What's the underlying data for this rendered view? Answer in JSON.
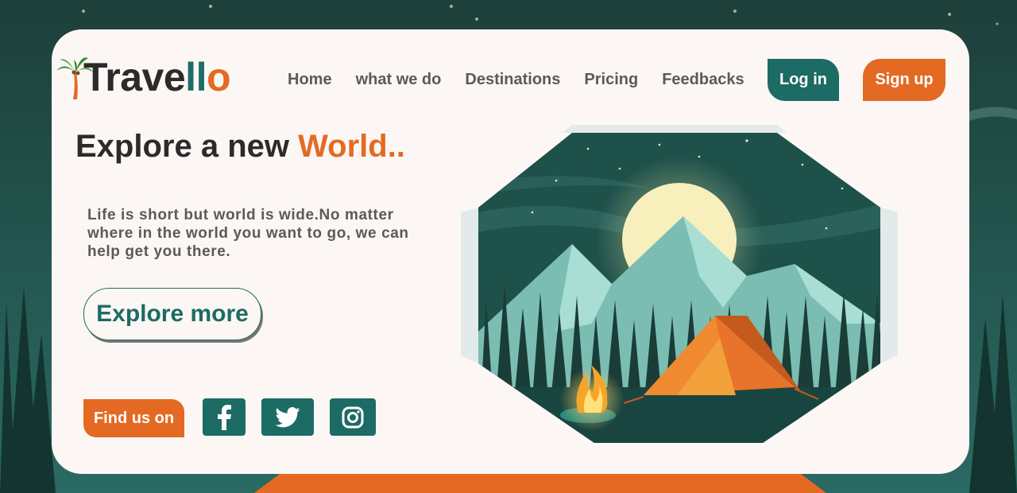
{
  "logo": {
    "part1": "Trave",
    "part2": "ll",
    "part3": "o"
  },
  "nav": [
    {
      "label": "Home"
    },
    {
      "label": "what we do"
    },
    {
      "label": "Destinations"
    },
    {
      "label": "Pricing"
    },
    {
      "label": "Feedbacks"
    }
  ],
  "auth": {
    "login_label": "Log in",
    "signup_label": "Sign up"
  },
  "hero": {
    "headline_part1": "Explore a new ",
    "headline_part2": "World..",
    "tagline": "Life is short but world is wide.No matter where in the world you want to go, we can help get you there.",
    "cta_label": "Explore more"
  },
  "social": {
    "label": "Find us on",
    "icons": [
      "facebook-icon",
      "twitter-icon",
      "instagram-icon"
    ]
  },
  "colors": {
    "teal": "#1c6b64",
    "orange": "#e46a24",
    "card": "#fcf7f5"
  }
}
